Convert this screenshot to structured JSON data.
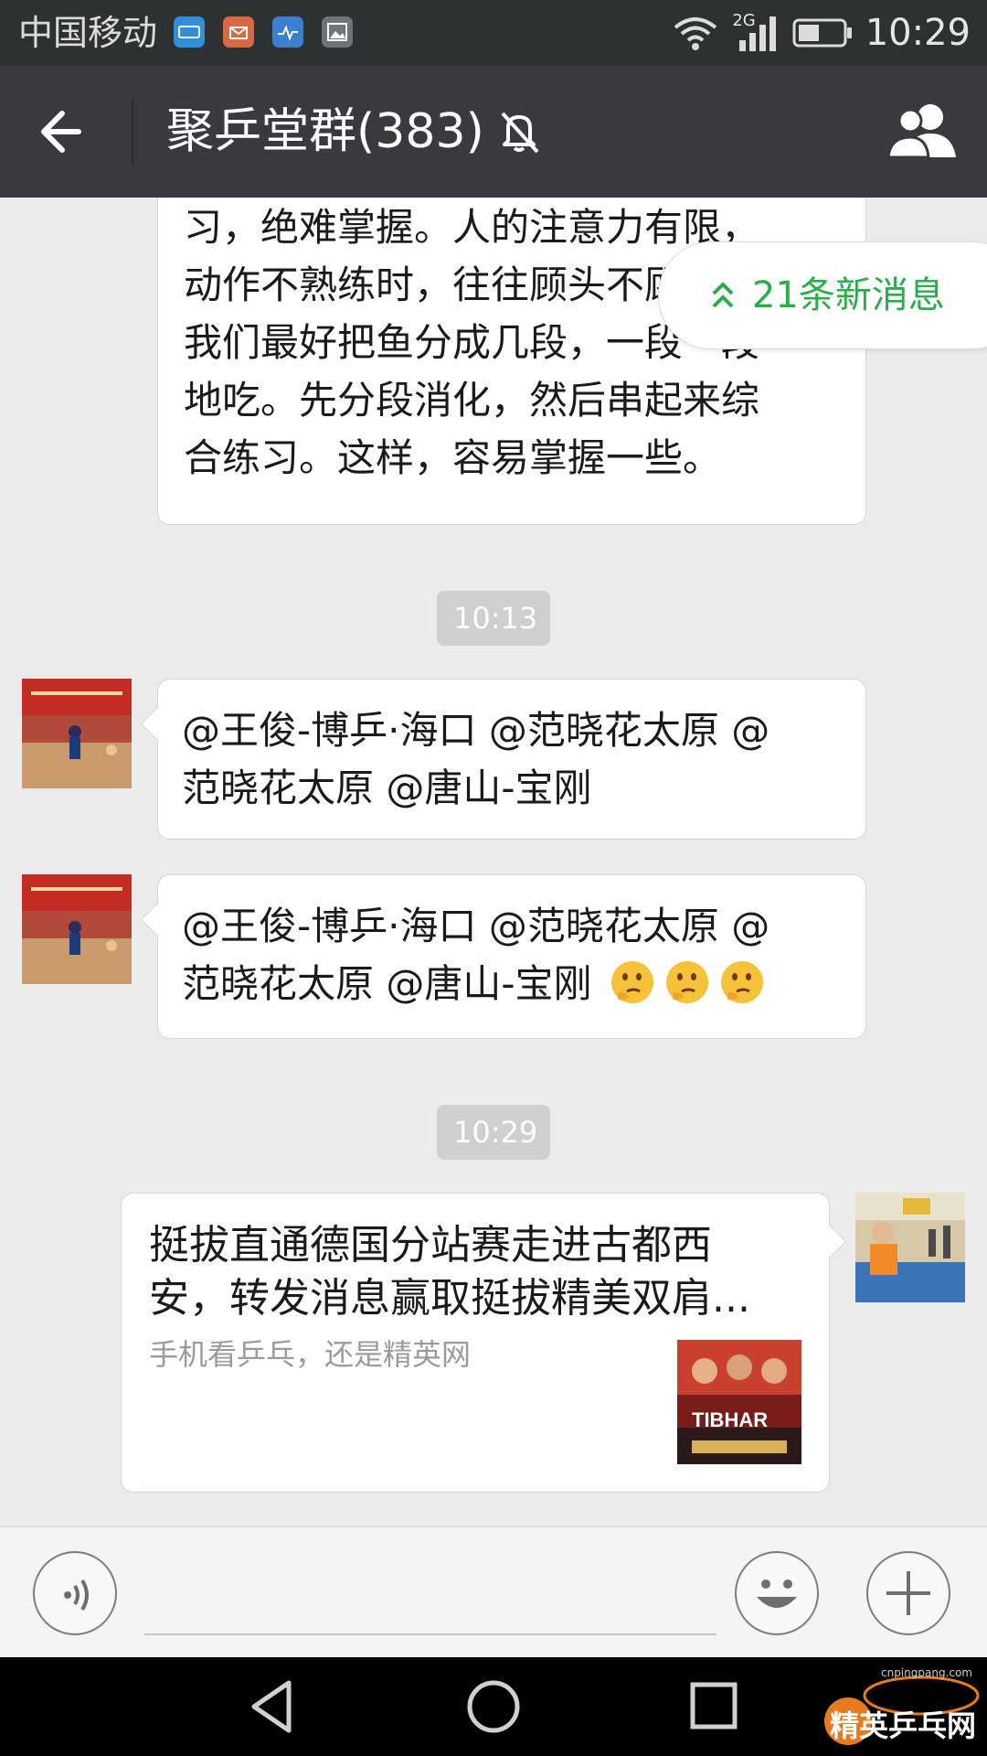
{
  "status_bar": {
    "carrier": "中国移动",
    "network": "2G",
    "time": "10:29"
  },
  "header": {
    "title": "聚乒堂群(383)",
    "back_icon": "back-arrow-icon",
    "mute_icon": "bell-off-icon",
    "members_icon": "group-members-icon"
  },
  "new_messages": {
    "label": "21条新消息",
    "icon": "double-chevron-up-icon",
    "color": "#2aae49"
  },
  "messages": [
    {
      "type": "text",
      "side": "left",
      "lines": [
        "习，绝难掌握。人的注意力有限，",
        "动作不熟练时，往往顾头不顾尾，",
        "我们最好把鱼分成几段，一段一段",
        "地吃。先分段消化，然后串起来综",
        "合练习。这样，容易掌握一些。"
      ]
    },
    {
      "type": "time",
      "text": "10:13"
    },
    {
      "type": "text",
      "side": "left",
      "lines": [
        "@王俊-博乒·海口 @范晓花太原 @",
        "范晓花太原 @唐山-宝刚"
      ]
    },
    {
      "type": "text",
      "side": "left",
      "lines": [
        "@王俊-博乒·海口 @范晓花太原 @",
        "范晓花太原 @唐山-宝刚"
      ],
      "emoji": [
        "thinking-face-icon",
        "thinking-face-icon",
        "thinking-face-icon"
      ]
    },
    {
      "type": "time",
      "text": "10:29"
    },
    {
      "type": "link",
      "side": "right",
      "title": "挺拔直通德国分站赛走进古都西安，转发消息赢取挺拔精美双肩...",
      "description": "手机看乒乓，还是精英网",
      "thumb_text": "TIBHAR"
    }
  ],
  "input_bar": {
    "voice_icon": "voice-icon",
    "emoji_icon": "smiley-icon",
    "more_icon": "plus-icon",
    "placeholder": ""
  },
  "nav_bar": {
    "back_icon": "triangle-back-icon",
    "home_icon": "circle-home-icon",
    "recents_icon": "square-recents-icon"
  },
  "watermark": {
    "brand": "精英乒乓网",
    "url": "cnpingpang.com"
  }
}
